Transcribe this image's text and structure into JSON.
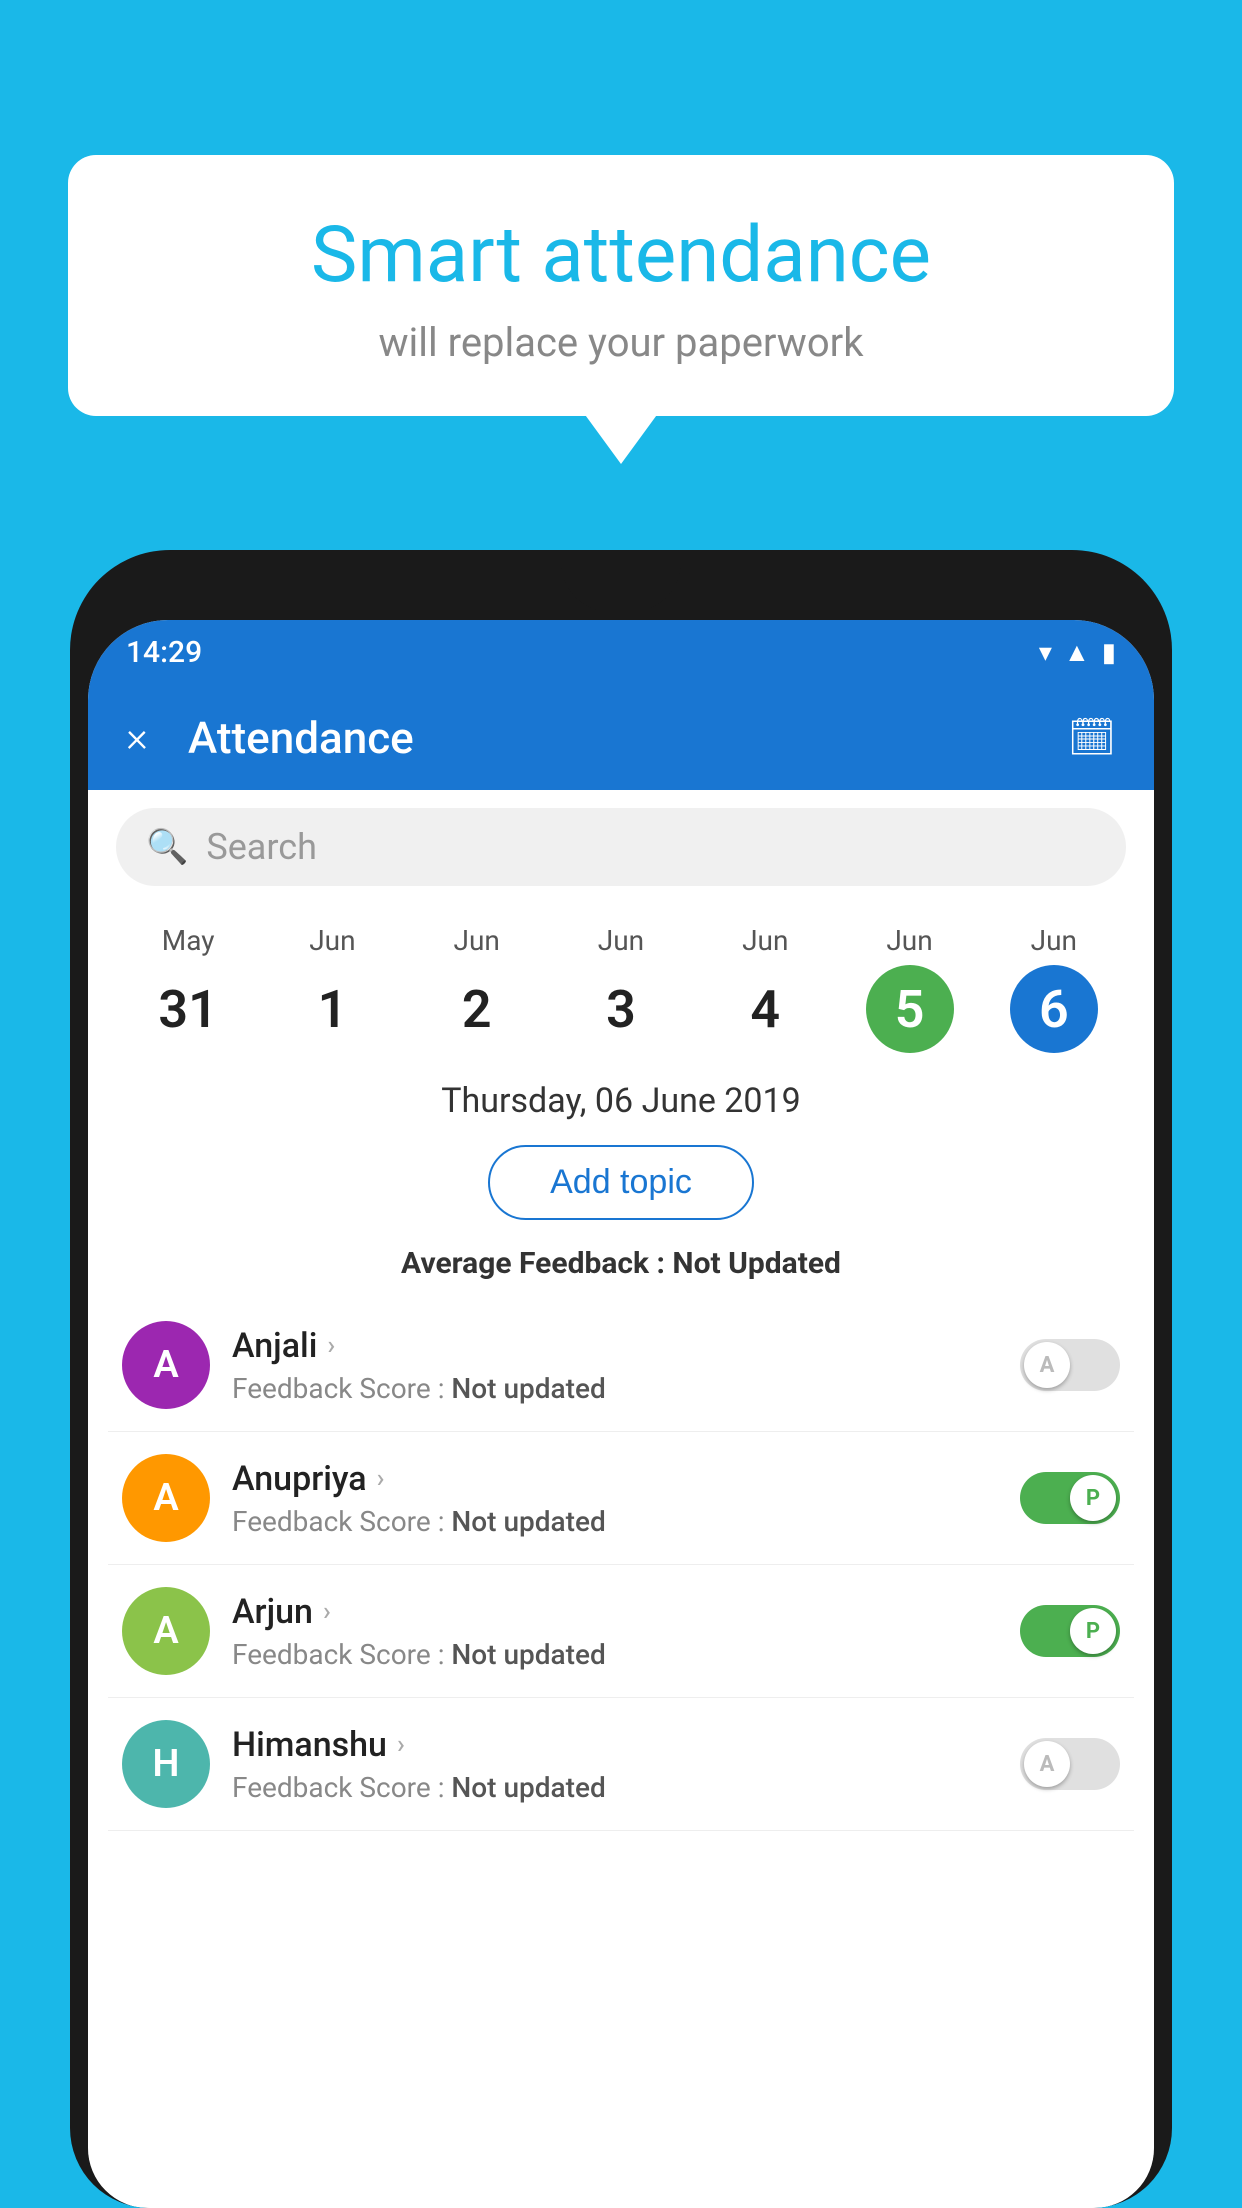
{
  "background_color": "#1ab8e8",
  "speech_bubble": {
    "title": "Smart attendance",
    "subtitle": "will replace your paperwork"
  },
  "app_bar": {
    "title": "Attendance",
    "close_icon": "×",
    "calendar_icon": "📅"
  },
  "status_bar": {
    "time": "14:29"
  },
  "search": {
    "placeholder": "Search"
  },
  "calendar": {
    "days": [
      {
        "month": "May",
        "date": "31",
        "style": "normal"
      },
      {
        "month": "Jun",
        "date": "1",
        "style": "normal"
      },
      {
        "month": "Jun",
        "date": "2",
        "style": "normal"
      },
      {
        "month": "Jun",
        "date": "3",
        "style": "normal"
      },
      {
        "month": "Jun",
        "date": "4",
        "style": "normal"
      },
      {
        "month": "Jun",
        "date": "5",
        "style": "green"
      },
      {
        "month": "Jun",
        "date": "6",
        "style": "blue"
      }
    ]
  },
  "selected_date": "Thursday, 06 June 2019",
  "add_topic_label": "Add topic",
  "avg_feedback_label": "Average Feedback :",
  "avg_feedback_value": "Not Updated",
  "students": [
    {
      "name": "Anjali",
      "avatar_letter": "A",
      "avatar_color": "purple",
      "feedback_label": "Feedback Score :",
      "feedback_value": "Not updated",
      "toggle": "off",
      "toggle_label": "A"
    },
    {
      "name": "Anupriya",
      "avatar_letter": "A",
      "avatar_color": "orange",
      "feedback_label": "Feedback Score :",
      "feedback_value": "Not updated",
      "toggle": "on",
      "toggle_label": "P"
    },
    {
      "name": "Arjun",
      "avatar_letter": "A",
      "avatar_color": "green-light",
      "feedback_label": "Feedback Score :",
      "feedback_value": "Not updated",
      "toggle": "on",
      "toggle_label": "P"
    },
    {
      "name": "Himanshu",
      "avatar_letter": "H",
      "avatar_color": "teal",
      "feedback_label": "Feedback Score :",
      "feedback_value": "Not updated",
      "toggle": "off",
      "toggle_label": "A"
    }
  ]
}
